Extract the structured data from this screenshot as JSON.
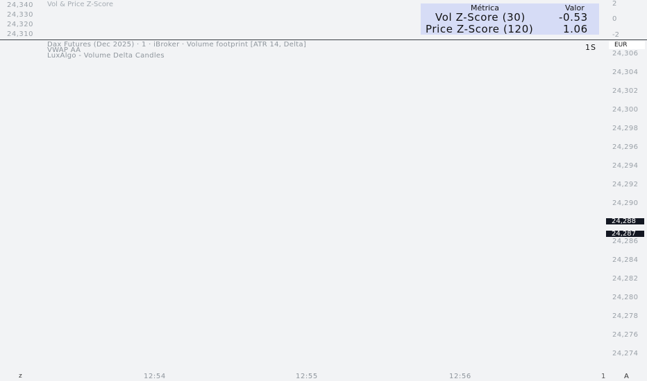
{
  "top_pane": {
    "price_labels": [
      "24,340",
      "24,330",
      "24,320",
      "24,310"
    ],
    "indicator_name": "Vol & Price Z-Score",
    "z_axis": [
      "2",
      "0",
      "-2"
    ],
    "table": {
      "header_metric": "Métrica",
      "header_value": "Valor",
      "rows": [
        {
          "metric": "Vol Z-Score (30)",
          "value": "-0.53"
        },
        {
          "metric": "Price Z-Score (120)",
          "value": "1.06"
        }
      ],
      "background": "#d6dcf6"
    }
  },
  "legend": {
    "symbol_line": "Dax Futures (Dec 2025) · 1 · iBroker · Volume footprint [ATR 14, Delta]",
    "vwap_line": "VWAP AA",
    "luxalgo_line": "LuxAlgo - Volume Delta Candles"
  },
  "countdown": "1S",
  "currency": "EUR",
  "price_axis": [
    "24,306",
    "24,304",
    "24,302",
    "24,300",
    "24,298",
    "24,296",
    "24,294",
    "24,292",
    "24,290",
    "24,288",
    "24,287",
    "24,286",
    "24,284",
    "24,282",
    "24,280",
    "24,278",
    "24,276",
    "24,274"
  ],
  "price_tags": [
    "24,288",
    "24,287"
  ],
  "time_axis": [
    "12:54",
    "12:55",
    "12:56"
  ],
  "bottom": {
    "tz_icon": "z",
    "log": "1",
    "auto": "A"
  },
  "colors": {
    "background": "#f2f3f5",
    "divider": "#3a3f44",
    "price_tag": "#131722"
  }
}
